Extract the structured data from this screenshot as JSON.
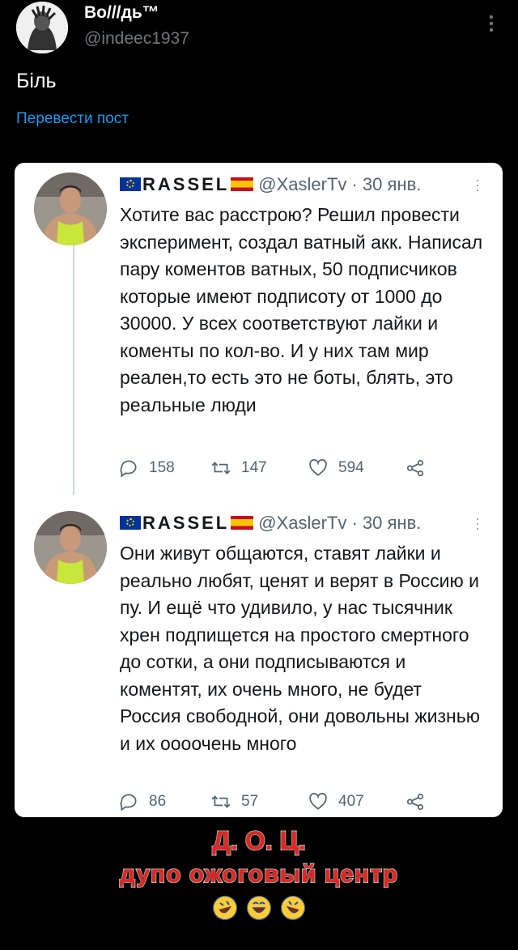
{
  "header": {
    "display_name": "Во///дь™",
    "handle": "@indeec1937",
    "more_icon": "more-vertical-icon"
  },
  "post": {
    "text": "Біль",
    "translate_label": "Перевести пост"
  },
  "embedded_tweets": [
    {
      "author_name": "RASSEL",
      "handle_date": "@XaslerTv · 30 янв.",
      "text": "Хотите вас расстрою? Решил провести эксперимент, создал ватный акк. Написал пару коментов ватных, 50 подписчиков которые имеют подписоту от 1000 до 30000. У всех соответствуют лайки и коменты по кол-во. И у них там мир реален,то есть это не боты, блять, это реальные люди",
      "replies": "158",
      "retweets": "147",
      "likes": "594"
    },
    {
      "author_name": "RASSEL",
      "handle_date": "@XaslerTv · 30 янв.",
      "text": "Они живут общаются, ставят лайки и реально любят, ценят и верят в Россию и пу. И ещё что удивило, у нас тысячник хрен подпищется на простого смертного до сотки, а они подписываются и коментят, их очень много, не будет Россия свободной, они довольны жизнью и их оооочень много",
      "replies": "86",
      "retweets": "57",
      "likes": "407"
    }
  ],
  "caption": {
    "line1": "Д. О. Ц.",
    "line2": "дупо ожоговый центр",
    "emojis": [
      "rofl-emoji",
      "joy-emoji",
      "rofl-emoji"
    ]
  },
  "colors": {
    "background": "#000000",
    "link": "#1d9bf0",
    "caption_red": "#e8231d",
    "card": "#ffffff"
  }
}
